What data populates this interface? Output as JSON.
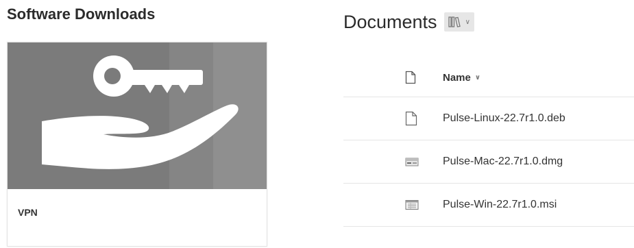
{
  "left_section": {
    "title": "Software Downloads",
    "card": {
      "label": "VPN",
      "image_icon": "key-in-hand-icon"
    }
  },
  "documents": {
    "title": "Documents",
    "view_button_icon": "library-view-icon",
    "header": {
      "name_label": "Name",
      "file_icon": "file-icon"
    },
    "files": [
      {
        "name": "Pulse-Linux-22.7r1.0.deb",
        "icon": "generic-file-icon"
      },
      {
        "name": "Pulse-Mac-22.7r1.0.dmg",
        "icon": "disk-image-file-icon"
      },
      {
        "name": "Pulse-Win-22.7r1.0.msi",
        "icon": "installer-file-icon"
      }
    ]
  },
  "colors": {
    "card_bg": "#7a7a7a",
    "view_button_bg": "#e6e6e6"
  }
}
